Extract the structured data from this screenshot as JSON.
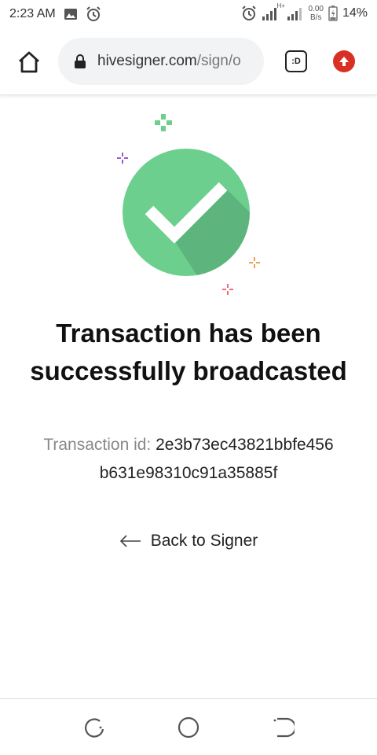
{
  "status_bar": {
    "time": "2:23 AM",
    "network_type": "H+",
    "speed_value": "0.00",
    "speed_unit": "B/s",
    "battery": "14%"
  },
  "browser": {
    "url_domain": "hivesigner.com",
    "url_path": "/sign/o",
    "tab_label": ":D"
  },
  "main": {
    "title": "Transaction has been successfully broadcasted",
    "txid_label": "Transaction id:",
    "txid_value": "2e3b73ec43821bbfe456b631e98310c91a35885f",
    "back_label": "Back to Signer"
  },
  "colors": {
    "success": "#6ccf8e",
    "success_shadow": "#5db57d",
    "update": "#d93025"
  }
}
